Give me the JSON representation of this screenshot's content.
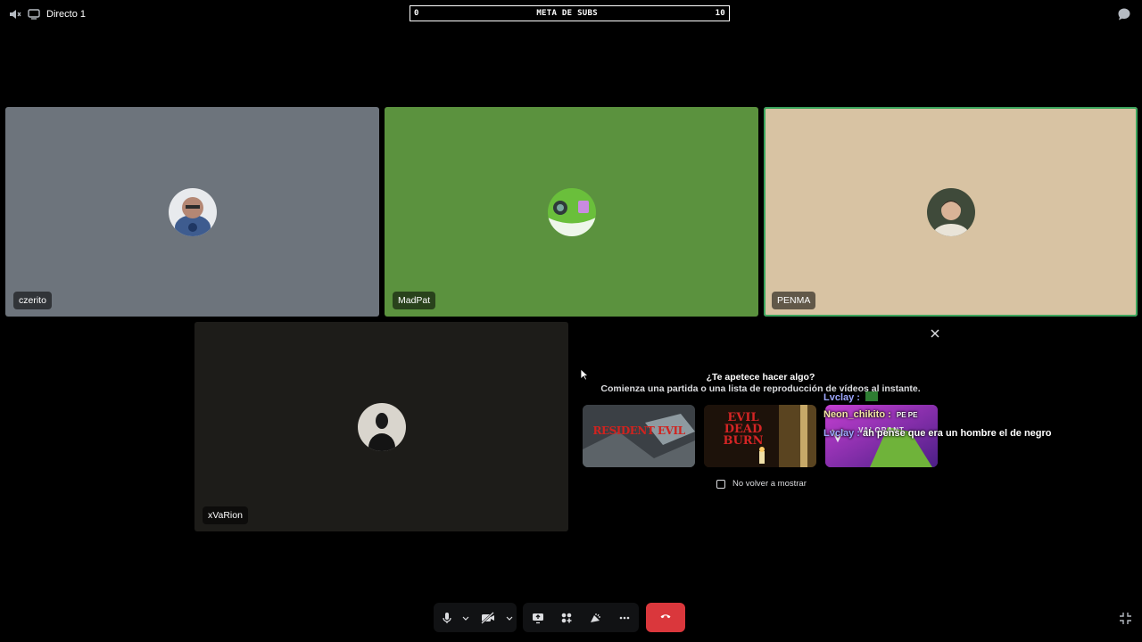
{
  "topbar": {
    "channel_name": "Directo 1",
    "speaker_icon": "speaker-muted-icon",
    "channel_icon": "voice-channel-icon",
    "chat_icon": "chat-bubble-icon"
  },
  "sub_goal": {
    "left": "0",
    "title": "META DE SUBS",
    "right": "10"
  },
  "participants": [
    {
      "name": "czerito",
      "bg": "#6d747c"
    },
    {
      "name": "MadPat",
      "bg": "#5b923e"
    },
    {
      "name": "PENMA",
      "bg": "#d8c3a3",
      "speaking": true,
      "speaking_color": "#3ba55d"
    },
    {
      "name": "xVaRion",
      "bg": "#1d1c19"
    }
  ],
  "activity": {
    "title": "¿Te apetece hacer algo?",
    "subtitle": "Comienza una partida o una lista de reproducción de vídeos al instante.",
    "games": [
      {
        "label": "RESIDENT EVIL",
        "sublabel": ""
      },
      {
        "label": "EVIL DEAD BURN",
        "sublabel": ""
      },
      {
        "label": "VALORANT",
        "sublabel": ""
      }
    ],
    "dont_show_label": "No volver a mostrar"
  },
  "chat_overlay": [
    {
      "user": "Lvclay :",
      "message": "",
      "user_color": "#9ea7ff"
    },
    {
      "user": "Neon_chikito :",
      "message": "PE PE",
      "user_color": "#f4e6a6"
    },
    {
      "user": "Lvclay :",
      "message": "ah pense que era un hombre el de negro",
      "user_color": "#9ea7ff"
    }
  ],
  "controls": {
    "mic_icon": "microphone-icon",
    "camera_icon": "camera-off-icon",
    "screen_icon": "screen-share-icon",
    "activities_icon": "activities-icon",
    "soundboard_icon": "soundboard-icon",
    "more_icon": "more-icon",
    "hangup_icon": "hang-up-icon",
    "hangup_color": "#da373c",
    "fullscreen_icon": "exit-fullscreen-icon"
  }
}
